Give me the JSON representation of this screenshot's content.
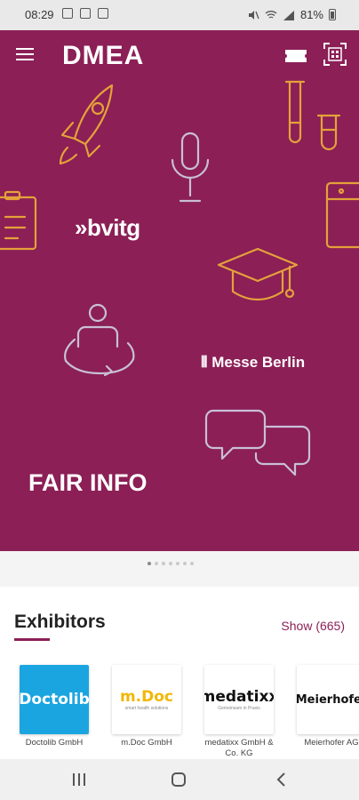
{
  "status_bar": {
    "time": "08:29",
    "battery": "81%"
  },
  "header": {
    "brand": "DMEA"
  },
  "hero": {
    "sponsor_bvitg": "bvitg",
    "sponsor_messe": "Messe Berlin",
    "title": "FAIR INFO",
    "background_color": "#8b1f56",
    "icon_line_color": "#e5a13a",
    "icon_line_color_alt": "#c9bfd6"
  },
  "pager": {
    "count": 7,
    "active_index": 0
  },
  "exhibitors": {
    "title": "Exhibitors",
    "show_label": "Show (665)",
    "items": [
      {
        "name": "Doctolib GmbH",
        "logo_text": "Doctolib",
        "logo_bg": "#1ba5e0",
        "logo_color": "#ffffff"
      },
      {
        "name": "m.Doc GmbH",
        "logo_text": "m.Doc",
        "logo_sub": "smart health solutions",
        "logo_bg": "#ffffff",
        "logo_color": "#f2b705"
      },
      {
        "name": "medatixx GmbH & Co. KG",
        "logo_text": "medatixx",
        "logo_sub": "Gemeinsam in Praxis",
        "logo_bg": "#ffffff",
        "logo_color": "#111111"
      },
      {
        "name": "Meierhofer AG",
        "logo_text": "Meierhofer",
        "logo_bg": "#ffffff",
        "logo_color": "#111111"
      }
    ]
  }
}
